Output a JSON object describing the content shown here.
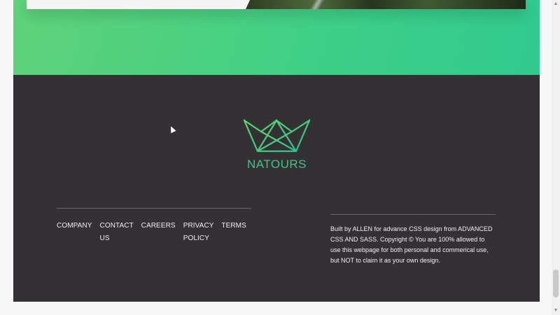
{
  "brand": {
    "name": "NATOURS",
    "logo_icon": "crown-icon",
    "accent_color": "#3ec48b"
  },
  "footer_nav": {
    "items": [
      {
        "label": "COMPANY"
      },
      {
        "label": "CONTACT US"
      },
      {
        "label": "CAREERS"
      },
      {
        "label": "PRIVACY POLICY"
      },
      {
        "label": "TERMS"
      }
    ]
  },
  "copyright": {
    "text": "Built by ALLEN for advance CSS design from ADVANCED CSS AND SASS. Copyright © You are 100% allowed to use this webpage for both personal and commerical use, but NOT to claim it as your own design."
  },
  "colors": {
    "section_green": "#3ecf87",
    "footer_bg": "#333133",
    "text_light": "#f1f1f1"
  }
}
